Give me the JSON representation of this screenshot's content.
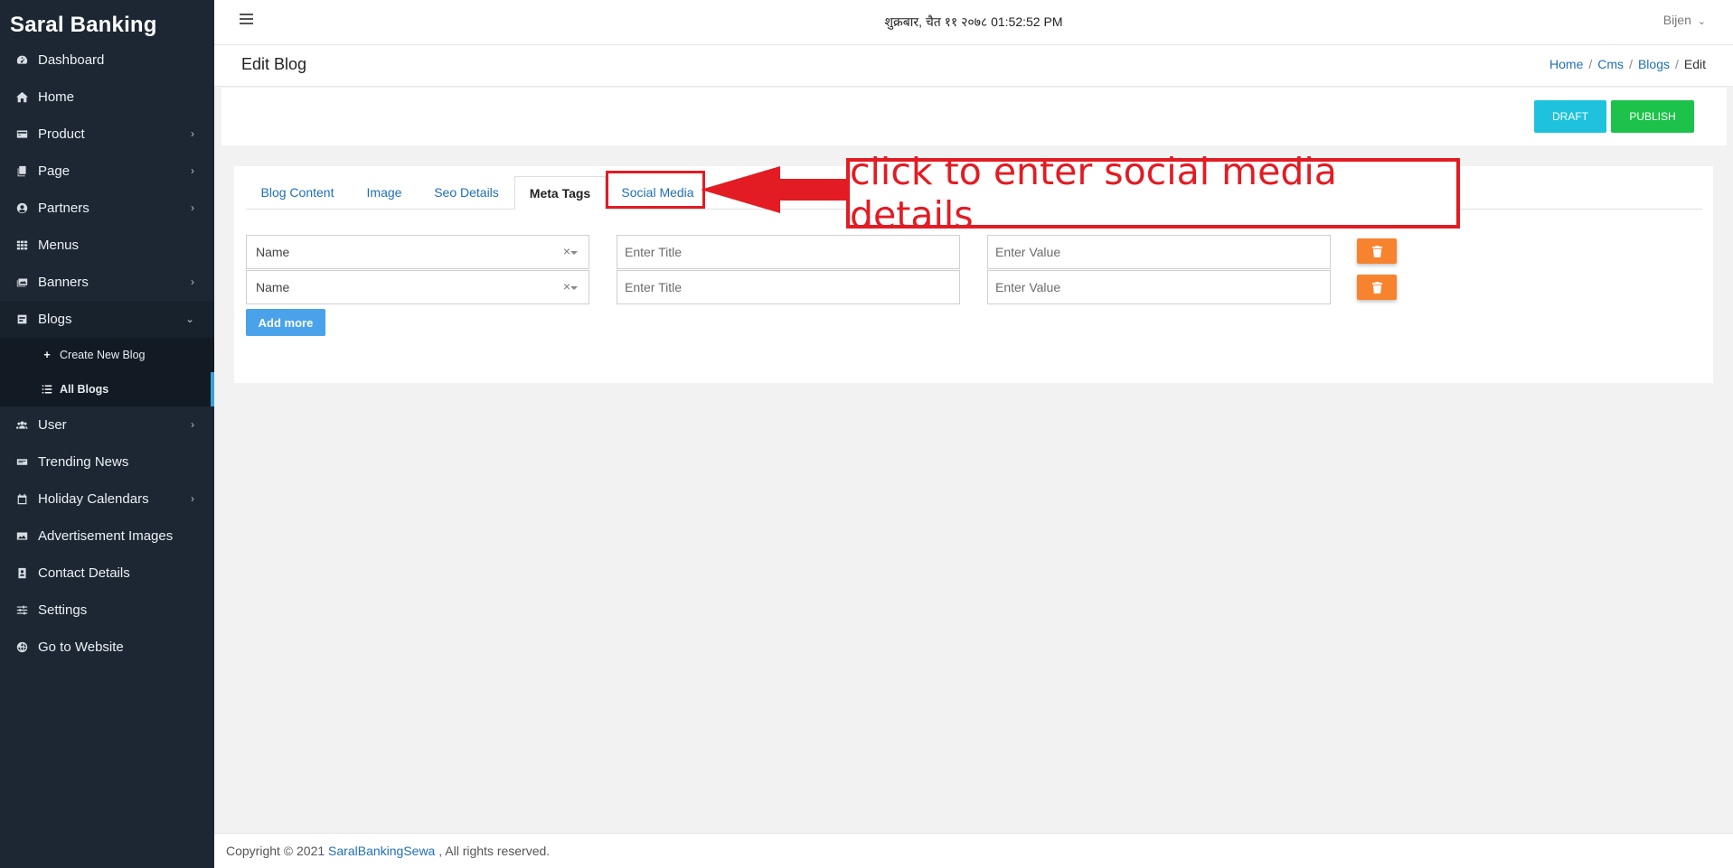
{
  "app": {
    "brand": "Saral Banking"
  },
  "header": {
    "datetime": "शुक्रबार, चैत ११ २०७८ 01:52:52 PM",
    "user": "Bijen",
    "user_caret": "⌄"
  },
  "page": {
    "title": "Edit Blog",
    "breadcrumb": {
      "home": "Home",
      "cms": "Cms",
      "blogs": "Blogs",
      "current": "Edit",
      "sep": "/"
    }
  },
  "actions": {
    "draft": "DRAFT",
    "publish": "PUBLISH"
  },
  "sidebar": {
    "items": [
      {
        "label": "Dashboard",
        "icon": "dashboard-icon"
      },
      {
        "label": "Home",
        "icon": "home-icon"
      },
      {
        "label": "Product",
        "icon": "product-icon",
        "chevron": "›"
      },
      {
        "label": "Page",
        "icon": "page-icon",
        "chevron": "›"
      },
      {
        "label": "Partners",
        "icon": "partners-icon",
        "chevron": "›"
      },
      {
        "label": "Menus",
        "icon": "menus-icon"
      },
      {
        "label": "Banners",
        "icon": "banners-icon",
        "chevron": "›"
      },
      {
        "label": "Blogs",
        "icon": "blogs-icon",
        "chevron": "⌄"
      },
      {
        "label": "User",
        "icon": "user-icon",
        "chevron": "›"
      },
      {
        "label": "Trending News",
        "icon": "news-icon"
      },
      {
        "label": "Holiday Calendars",
        "icon": "calendar-icon",
        "chevron": "›"
      },
      {
        "label": "Advertisement Images",
        "icon": "image-icon"
      },
      {
        "label": "Contact Details",
        "icon": "contact-icon"
      },
      {
        "label": "Settings",
        "icon": "settings-icon"
      },
      {
        "label": "Go to Website",
        "icon": "globe-icon"
      }
    ],
    "blog_sub": [
      {
        "label": "Create New Blog",
        "icon": "plus-icon"
      },
      {
        "label": "All Blogs",
        "icon": "list-icon"
      }
    ]
  },
  "tabs": [
    "Blog Content",
    "Image",
    "Seo Details",
    "Meta Tags",
    "Social Media"
  ],
  "active_tab": "Meta Tags",
  "meta_rows": [
    {
      "name": "Name",
      "title_placeholder": "Enter Title",
      "value_placeholder": "Enter Value",
      "clear": "×"
    },
    {
      "name": "Name",
      "title_placeholder": "Enter Title",
      "value_placeholder": "Enter Value",
      "clear": "×"
    }
  ],
  "add_more": "Add more",
  "annotation": {
    "text": "click to enter social media details",
    "color": "#e31b23"
  },
  "footer": {
    "prefix": "Copyright © 2021 ",
    "link": "SaralBankingSewa",
    "suffix": " , All rights reserved."
  }
}
